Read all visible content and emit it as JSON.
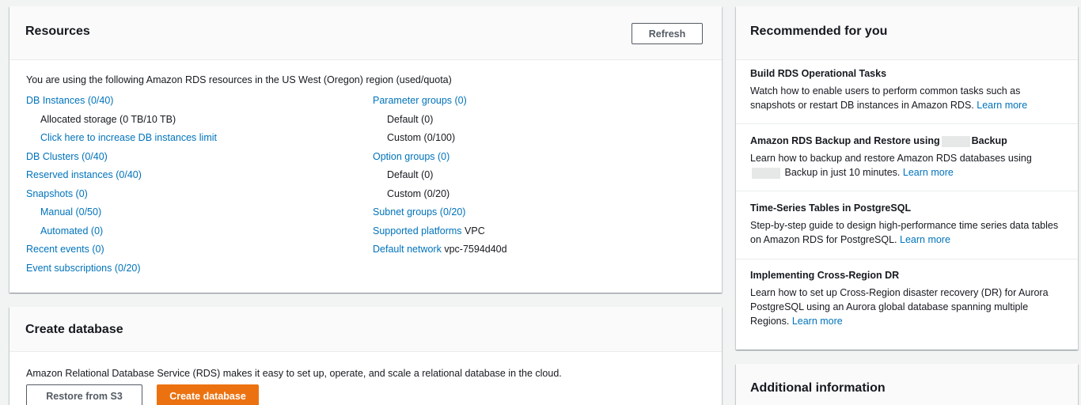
{
  "resources": {
    "title": "Resources",
    "refresh_label": "Refresh",
    "intro": "You are using the following Amazon RDS resources in the US West (Oregon) region (used/quota)",
    "left": {
      "db_instances": "DB Instances (0/40)",
      "allocated_storage": "Allocated storage (0 TB/10 TB)",
      "increase_limit": "Click here to increase DB instances limit",
      "db_clusters": "DB Clusters (0/40)",
      "reserved_instances": "Reserved instances (0/40)",
      "snapshots": "Snapshots (0)",
      "manual": "Manual (0/50)",
      "automated": "Automated (0)",
      "recent_events": "Recent events (0)",
      "event_subscriptions": "Event subscriptions (0/20)"
    },
    "right": {
      "parameter_groups": "Parameter groups (0)",
      "pg_default": "Default (0)",
      "pg_custom": "Custom (0/100)",
      "option_groups": "Option groups (0)",
      "og_default": "Default (0)",
      "og_custom": "Custom (0/20)",
      "subnet_groups": "Subnet groups (0/20)",
      "supported_platforms_label": "Supported platforms",
      "supported_platforms_value": "VPC",
      "default_network_label": "Default network",
      "default_network_value": "vpc-7594d40d"
    }
  },
  "create_db": {
    "title": "Create database",
    "description": "Amazon Relational Database Service (RDS) makes it easy to set up, operate, and scale a relational database in the cloud.",
    "restore_label": "Restore from S3",
    "create_label": "Create database"
  },
  "recommended": {
    "title": "Recommended for you",
    "items": [
      {
        "title": "Build RDS Operational Tasks",
        "body": "Watch how to enable users to perform common tasks such as snapshots or restart DB instances in Amazon RDS.",
        "link": "Learn more"
      },
      {
        "title_before": "Amazon RDS Backup and Restore using",
        "title_after": "Backup",
        "body_before": "Learn how to backup and restore Amazon RDS databases using",
        "body_after": "Backup in just 10 minutes.",
        "link": "Learn more"
      },
      {
        "title": "Time-Series Tables in PostgreSQL",
        "body": "Step-by-step guide to design high-performance time series data tables on Amazon RDS for PostgreSQL.",
        "link": "Learn more"
      },
      {
        "title": "Implementing Cross-Region DR",
        "body": "Learn how to set up Cross-Region disaster recovery (DR) for Aurora PostgreSQL using an Aurora global database spanning multiple Regions.",
        "link": "Learn more"
      }
    ]
  },
  "additional": {
    "title": "Additional information"
  },
  "colors": {
    "link": "#0073bb",
    "primary_button": "#ec7211",
    "background": "#f2f3f3"
  }
}
